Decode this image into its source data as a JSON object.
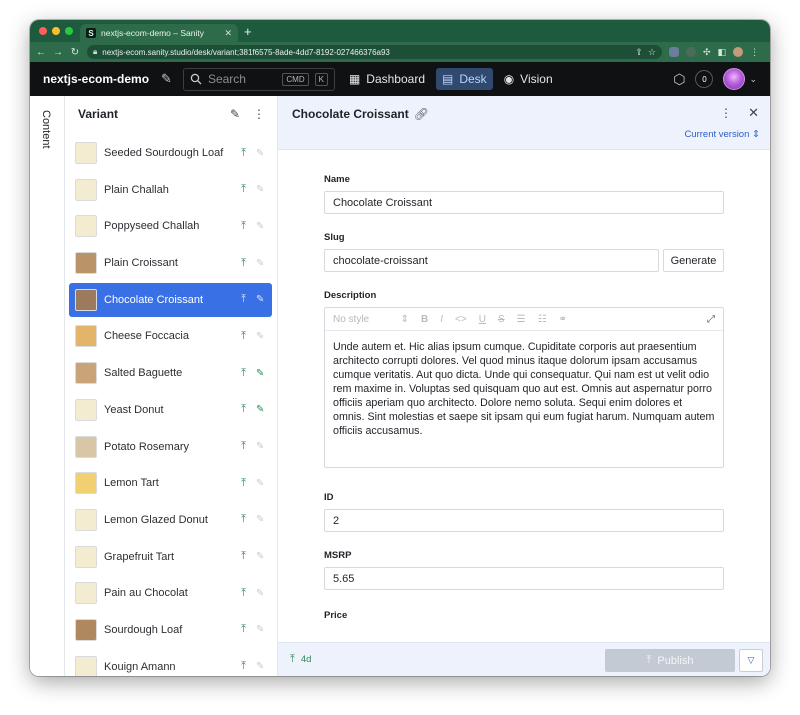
{
  "browser": {
    "tab_title": "nextjs-ecom-demo – Sanity",
    "favicon": "S",
    "new_tab": "+",
    "url": "nextjs-ecom.sanity.studio/desk/variant;381f6575-8ade-4dd7-8192-027466376a93"
  },
  "app": {
    "brand": "nextjs-ecom-demo",
    "search_placeholder": "Search",
    "shortcut_cmd": "CMD",
    "shortcut_key": "K",
    "tools": [
      "Dashboard",
      "Desk",
      "Vision"
    ],
    "active_tool": "Desk",
    "notification_count": "0"
  },
  "rail": {
    "label": "Content"
  },
  "list": {
    "title": "Variant",
    "items": [
      {
        "label": "Seeded Sourdough Loaf",
        "thumb": "#f4ecd0",
        "draft": false
      },
      {
        "label": "Plain Challah",
        "thumb": "#f4ecd0",
        "draft": false
      },
      {
        "label": "Poppyseed Challah",
        "thumb": "#f4ecd0",
        "draft": false
      },
      {
        "label": "Plain Croissant",
        "thumb": "#b89468",
        "draft": false
      },
      {
        "label": "Chocolate Croissant",
        "thumb": "#9c7a5e",
        "draft": false,
        "selected": true
      },
      {
        "label": "Cheese Foccacia",
        "thumb": "#e2b56a",
        "draft": false
      },
      {
        "label": "Salted Baguette",
        "thumb": "#c9a478",
        "draft": true
      },
      {
        "label": "Yeast Donut",
        "thumb": "#f4ecd0",
        "draft": true
      },
      {
        "label": "Potato Rosemary",
        "thumb": "#d9c6a6",
        "draft": false
      },
      {
        "label": "Lemon Tart",
        "thumb": "#f0d070",
        "draft": false
      },
      {
        "label": "Lemon Glazed Donut",
        "thumb": "#f4ecd0",
        "draft": false
      },
      {
        "label": "Grapefruit Tart",
        "thumb": "#f4ecd0",
        "draft": false
      },
      {
        "label": "Pain au Chocolat",
        "thumb": "#f4ecd0",
        "draft": false
      },
      {
        "label": "Sourdough Loaf",
        "thumb": "#b08860",
        "draft": false
      },
      {
        "label": "Kouign Amann",
        "thumb": "#f4ecd0",
        "draft": false
      }
    ]
  },
  "document": {
    "title": "Chocolate Croissant",
    "version": "Current version",
    "name_label": "Name",
    "name_value": "Chocolate Croissant",
    "slug_label": "Slug",
    "slug_value": "chocolate-croissant",
    "generate_label": "Generate",
    "description_label": "Description",
    "style_placeholder": "No style",
    "description_text": "Unde autem et. Hic alias ipsum cumque. Cupiditate corporis aut praesentium architecto corrupti dolores. Vel quod minus itaque dolorum ipsam accusamus cumque veritatis. Aut quo dicta. Unde qui consequatur. Qui nam est ut velit odio rem maxime in. Voluptas sed quisquam quo aut est. Omnis aut aspernatur porro officiis aperiam quo architecto. Dolore nemo soluta. Sequi enim dolores et omnis. Sint molestias et saepe sit ipsam qui eum fugiat harum. Numquam autem officiis accusamus.",
    "id_label": "ID",
    "id_value": "2",
    "msrp_label": "MSRP",
    "msrp_value": "5.65",
    "price_label": "Price"
  },
  "footer": {
    "published_age": "4d",
    "publish_label": "Publish"
  },
  "colors": {
    "accent": "#3a70e6",
    "published": "#2e8a54",
    "header_bg": "#101112",
    "browser_bg": "#2d6b4a"
  }
}
